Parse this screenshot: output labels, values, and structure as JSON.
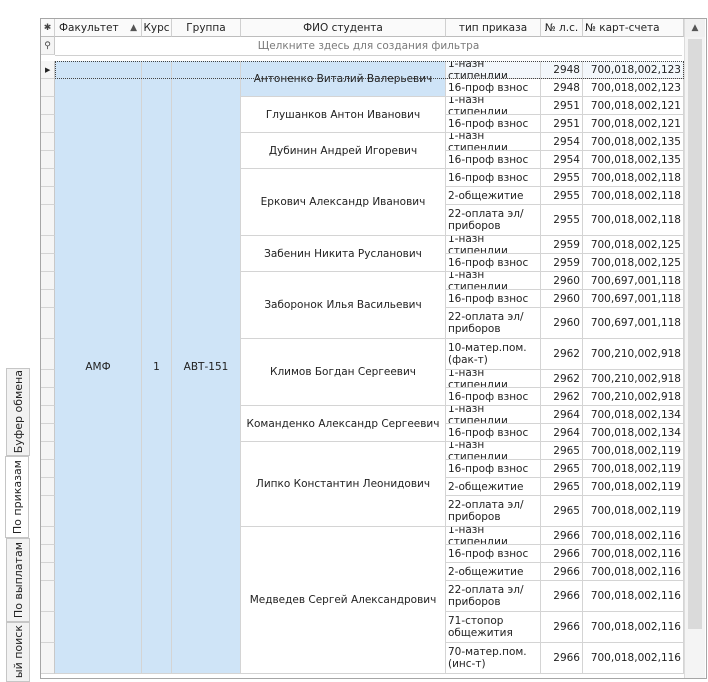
{
  "side_tabs": [
    {
      "label": "Буфер обмена",
      "active": false
    },
    {
      "label": "По приказам",
      "active": true
    },
    {
      "label": "По выплатам",
      "active": false
    },
    {
      "label": "ый поиск",
      "active": false
    }
  ],
  "grid": {
    "columns": [
      "Факультет",
      "Курс",
      "Группа",
      "ФИО студента",
      "тип приказа",
      "№ л.с.",
      "№ карт-счета"
    ],
    "sort_icon": "sort-ascending-icon",
    "new_row_icon": "asterisk-icon",
    "filter_icon": "filter-icon",
    "filter_hint": "Щелкните здесь для создания фильтра",
    "group": {
      "faculty": "АМФ",
      "course": "1",
      "group": "АВТ-151"
    },
    "students": [
      {
        "name": "Антоненко Виталий Валерьевич",
        "records": [
          {
            "type": "1-назн стипендии",
            "ls": "2948",
            "acct": "700,018,002,123"
          },
          {
            "type": "16-проф взнос",
            "ls": "2948",
            "acct": "700,018,002,123"
          }
        ]
      },
      {
        "name": "Глушанков Антон Иванович",
        "records": [
          {
            "type": "1-назн стипендии",
            "ls": "2951",
            "acct": "700,018,002,121"
          },
          {
            "type": "16-проф взнос",
            "ls": "2951",
            "acct": "700,018,002,121"
          }
        ]
      },
      {
        "name": "Дубинин Андрей Игоревич",
        "records": [
          {
            "type": "1-назн стипендии",
            "ls": "2954",
            "acct": "700,018,002,135"
          },
          {
            "type": "16-проф взнос",
            "ls": "2954",
            "acct": "700,018,002,135"
          }
        ]
      },
      {
        "name": "Еркович Александр Иванович",
        "records": [
          {
            "type": "16-проф взнос",
            "ls": "2955",
            "acct": "700,018,002,118"
          },
          {
            "type": "2-общежитие",
            "ls": "2955",
            "acct": "700,018,002,118"
          },
          {
            "type": "22-оплата эл/приборов",
            "ls": "2955",
            "acct": "700,018,002,118"
          }
        ]
      },
      {
        "name": "Забенин Никита Русланович",
        "records": [
          {
            "type": "1-назн стипендии",
            "ls": "2959",
            "acct": "700,018,002,125"
          },
          {
            "type": "16-проф взнос",
            "ls": "2959",
            "acct": "700,018,002,125"
          }
        ]
      },
      {
        "name": "Заборонок Илья Васильевич",
        "records": [
          {
            "type": "1-назн стипендии",
            "ls": "2960",
            "acct": "700,697,001,118"
          },
          {
            "type": "16-проф взнос",
            "ls": "2960",
            "acct": "700,697,001,118"
          },
          {
            "type": "22-оплата эл/приборов",
            "ls": "2960",
            "acct": "700,697,001,118"
          }
        ]
      },
      {
        "name": "Климов Богдан Сергеевич",
        "records": [
          {
            "type": "10-матер.пом.(фак-т)",
            "ls": "2962",
            "acct": "700,210,002,918"
          },
          {
            "type": "1-назн стипендии",
            "ls": "2962",
            "acct": "700,210,002,918"
          },
          {
            "type": "16-проф взнос",
            "ls": "2962",
            "acct": "700,210,002,918"
          }
        ]
      },
      {
        "name": "Команденко Александр Сергеевич",
        "records": [
          {
            "type": "1-назн стипендии",
            "ls": "2964",
            "acct": "700,018,002,134"
          },
          {
            "type": "16-проф взнос",
            "ls": "2964",
            "acct": "700,018,002,134"
          }
        ]
      },
      {
        "name": "Липко Константин Леонидович",
        "records": [
          {
            "type": "1-назн стипендии",
            "ls": "2965",
            "acct": "700,018,002,119"
          },
          {
            "type": "16-проф взнос",
            "ls": "2965",
            "acct": "700,018,002,119"
          },
          {
            "type": "2-общежитие",
            "ls": "2965",
            "acct": "700,018,002,119"
          },
          {
            "type": "22-оплата эл/приборов",
            "ls": "2965",
            "acct": "700,018,002,119"
          }
        ]
      },
      {
        "name": "Медведев Сергей Александрович",
        "records": [
          {
            "type": "1-назн стипендии",
            "ls": "2966",
            "acct": "700,018,002,116"
          },
          {
            "type": "16-проф взнос",
            "ls": "2966",
            "acct": "700,018,002,116"
          },
          {
            "type": "2-общежитие",
            "ls": "2966",
            "acct": "700,018,002,116"
          },
          {
            "type": "22-оплата эл/приборов",
            "ls": "2966",
            "acct": "700,018,002,116"
          },
          {
            "type": "71-стопор общежития",
            "ls": "2966",
            "acct": "700,018,002,116"
          },
          {
            "type": "70-матер.пом.(инс-т)",
            "ls": "2966",
            "acct": "700,018,002,116"
          }
        ]
      }
    ]
  },
  "colors": {
    "merged_bg": "#cfe4f7",
    "selected_row_bg": "#f3f7fb",
    "grid_line": "#d4d4d4"
  }
}
